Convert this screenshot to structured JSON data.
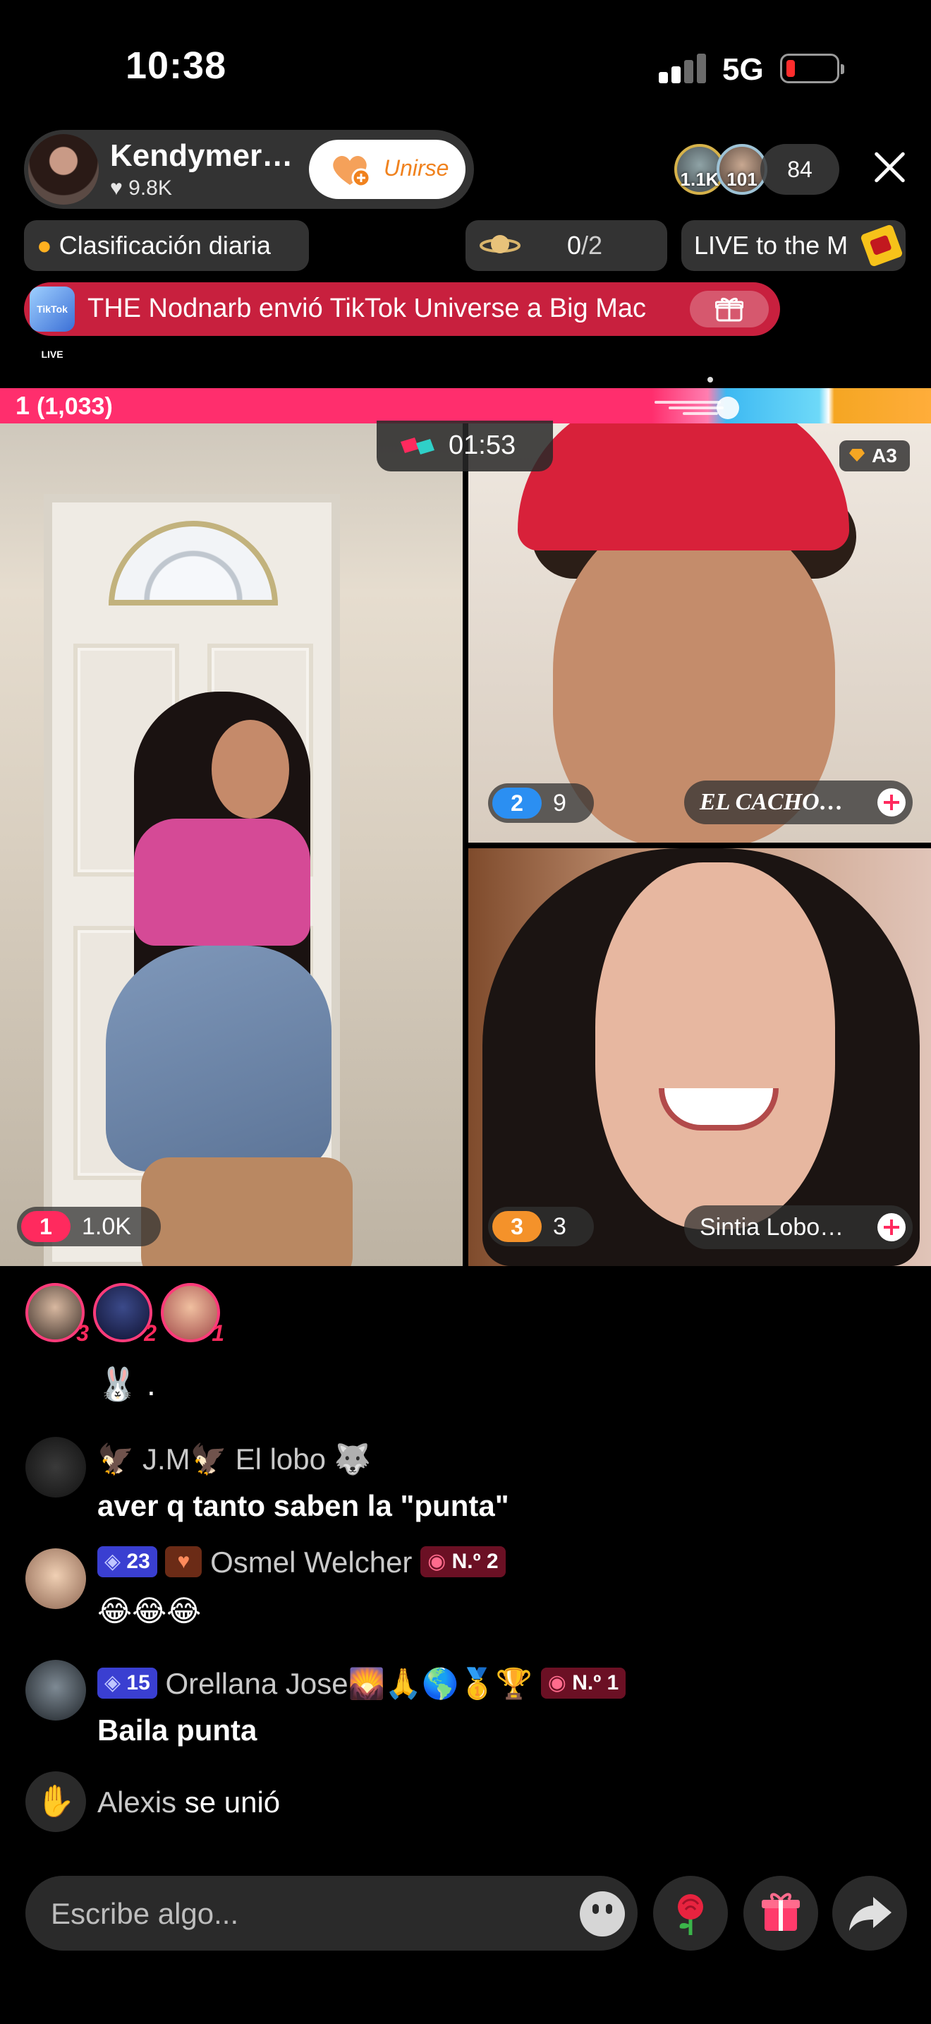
{
  "status_bar": {
    "time": "10:38",
    "network": "5G"
  },
  "host": {
    "name": "Kendymer…",
    "likes": "♥ 9.8K",
    "join_label": "Unirse"
  },
  "viewers": {
    "avatar_1_count": "1.1K",
    "avatar_2_count": "101",
    "total": "84"
  },
  "chips": {
    "daily_ranking": "Clasificación diaria",
    "planet_current": "0",
    "planet_total": "/2",
    "live_to_the": "LIVE to the M"
  },
  "gift_banner": {
    "text": "THE Nodnarb envió TikTok Universe a Big Mac",
    "icon_text": "TikTok LIVE"
  },
  "battle": {
    "rank": "1",
    "score": "(1,033)",
    "timer": "01:53"
  },
  "players": [
    {
      "rank": "1",
      "points": "1.0K"
    },
    {
      "rank": "2",
      "points": "9",
      "name": "EL CACHO…",
      "tag": "A3"
    },
    {
      "rank": "3",
      "points": "3",
      "name": "Sintia Lobo…"
    }
  ],
  "top_gifters": [
    "3",
    "2",
    "1"
  ],
  "chat": {
    "rabbit_line": "🐰 .",
    "messages": [
      {
        "user": "🦅 J.M🦅  El lobo 🐺",
        "text": "aver q tanto saben la \"punta\""
      },
      {
        "level": "23",
        "user": "Osmel Welcher",
        "rank_badge": "N.º 2",
        "text": "😂😂😂"
      },
      {
        "level": "15",
        "user": "Orellana Jose🌄🙏🌎🥇🏆",
        "rank_badge": "N.º 1",
        "text": "Baila punta"
      }
    ],
    "join": {
      "user": "Alexis",
      "text": "se unió"
    }
  },
  "composer": {
    "placeholder": "Escribe algo..."
  },
  "colors": {
    "accent": "#ff2a5e",
    "join_orange": "#f0821e",
    "banner_red": "#c8203e",
    "rank2_blue": "#2b8ff2",
    "rank3_orange": "#f4922a"
  }
}
